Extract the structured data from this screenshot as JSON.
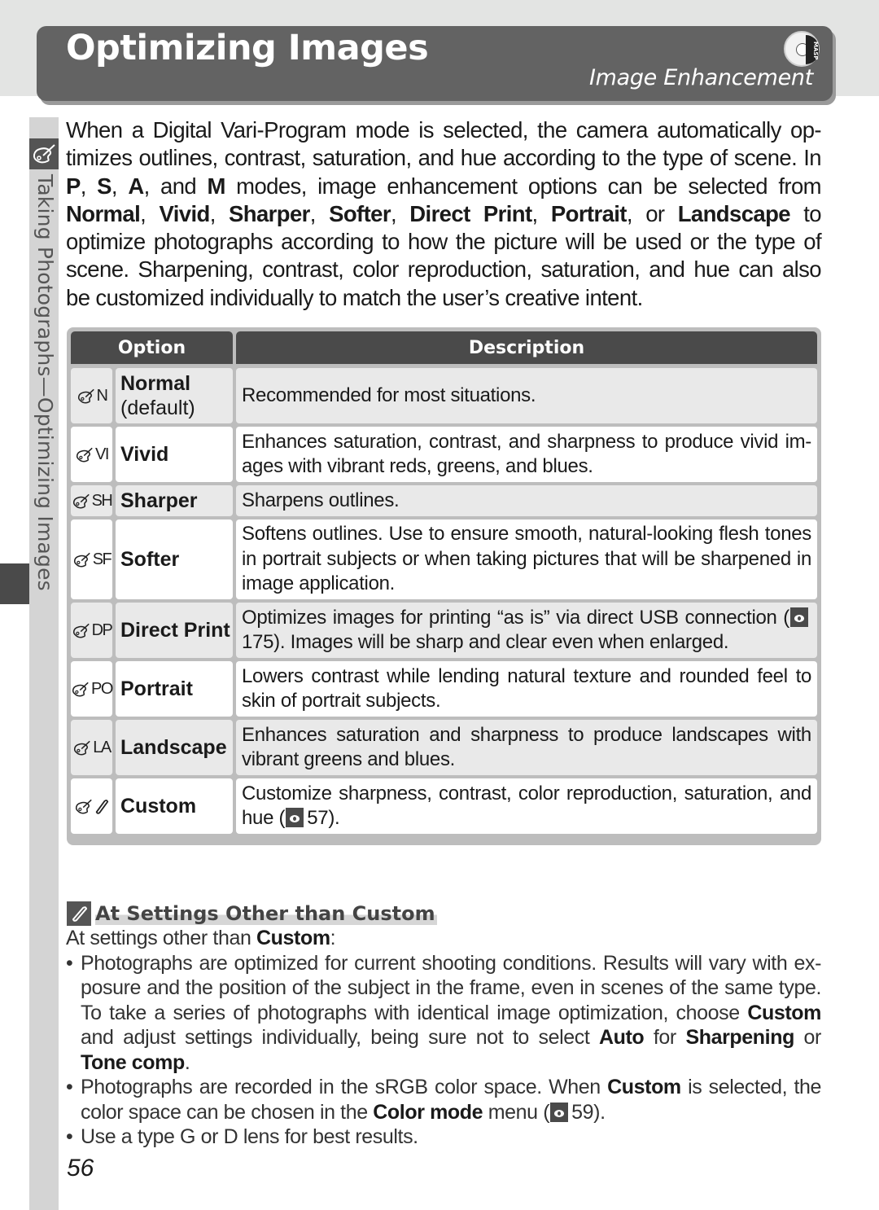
{
  "header": {
    "title": "Optimizing Images",
    "subtitle": "Image Enhancement",
    "dial_letters": "MASP"
  },
  "side_tab": {
    "label": "Taking Photographs—Optimizing Images"
  },
  "intro": {
    "parts": [
      {
        "t": "When a Digital Vari-Program mode is selected, the camera automatically op-timizes outlines, contrast, saturation, and hue according to the type of scene. In ",
        "b": false
      },
      {
        "t": "P",
        "b": true
      },
      {
        "t": ", ",
        "b": false
      },
      {
        "t": "S",
        "b": true
      },
      {
        "t": ", ",
        "b": false
      },
      {
        "t": "A",
        "b": true
      },
      {
        "t": ", and ",
        "b": false
      },
      {
        "t": "M",
        "b": true
      },
      {
        "t": " modes, image enhancement options can be selected from ",
        "b": false
      },
      {
        "t": "Normal",
        "b": true
      },
      {
        "t": ", ",
        "b": false
      },
      {
        "t": "Vivid",
        "b": true
      },
      {
        "t": ", ",
        "b": false
      },
      {
        "t": "Sharper",
        "b": true
      },
      {
        "t": ", ",
        "b": false
      },
      {
        "t": "Softer",
        "b": true
      },
      {
        "t": ", ",
        "b": false
      },
      {
        "t": "Direct Print",
        "b": true
      },
      {
        "t": ", ",
        "b": false
      },
      {
        "t": "Portrait",
        "b": true
      },
      {
        "t": ", or ",
        "b": false
      },
      {
        "t": "Landscape",
        "b": true
      },
      {
        "t": " to optimize photographs according to how the picture will be used or the type of scene.  Sharpening, contrast, color reproduction, saturation, and hue can also be customized individually to match the user’s creative intent.",
        "b": false
      }
    ]
  },
  "table": {
    "headers": {
      "option": "Option",
      "description": "Description"
    },
    "rows": [
      {
        "code": "N",
        "name": "Normal",
        "note": "(default)",
        "desc": "Recommended for most situations.",
        "ref": null,
        "desc_after": "",
        "bg": "grey",
        "h": 68
      },
      {
        "code": "VI",
        "name": "Vivid",
        "note": "",
        "desc": "Enhances saturation, contrast, and sharpness to produce vivid im-ages with vibrant reds, greens, and blues.",
        "ref": null,
        "desc_after": "",
        "bg": "white",
        "h": 68
      },
      {
        "code": "SH",
        "name": "Sharper",
        "note": "",
        "desc": "Sharpens outlines.",
        "ref": null,
        "desc_after": "",
        "bg": "grey",
        "h": 38
      },
      {
        "code": "SF",
        "name": "Softer",
        "note": "",
        "desc": "Softens outlines.  Use to ensure smooth, natural-looking flesh tones in portrait subjects or when taking pictures that will be sharpened in image application.",
        "ref": null,
        "desc_after": "",
        "bg": "white",
        "h": 98
      },
      {
        "code": "DP",
        "name": "Direct Print",
        "note": "",
        "desc": "Optimizes images for printing “as is” via direct USB connection (",
        "ref": "175",
        "desc_after": ").  Images will be sharp and clear even when enlarged.",
        "bg": "grey",
        "h": 68
      },
      {
        "code": "PO",
        "name": "Portrait",
        "note": "",
        "desc": "Lowers contrast while lending natural texture and rounded feel to skin of portrait subjects.",
        "ref": null,
        "desc_after": "",
        "bg": "white",
        "h": 68
      },
      {
        "code": "LA",
        "name": "Landscape",
        "note": "",
        "desc": "Enhances saturation and sharpness to produce landscapes with vibrant greens and blues.",
        "ref": null,
        "desc_after": "",
        "bg": "grey",
        "h": 68
      },
      {
        "code": "",
        "name": "Custom",
        "note": "",
        "desc": "Customize sharpness, contrast, color reproduction, saturation, and hue (",
        "ref": "57",
        "desc_after": ").",
        "bg": "white",
        "h": 68
      }
    ]
  },
  "note": {
    "title": "At Settings Other than Custom",
    "lead": [
      {
        "t": "At settings other than ",
        "b": false
      },
      {
        "t": "Custom",
        "b": true
      },
      {
        "t": ":",
        "b": false
      }
    ],
    "bullets": [
      [
        {
          "t": "Photographs are optimized for current shooting conditions.  Results will vary with ex-posure and the position of the subject in the frame, even in scenes of the same type.  To take a series of photographs with identical image optimization, choose ",
          "b": false
        },
        {
          "t": "Custom",
          "b": true
        },
        {
          "t": " and adjust settings individually, being sure not to select ",
          "b": false
        },
        {
          "t": "Auto",
          "b": true
        },
        {
          "t": " for ",
          "b": false
        },
        {
          "t": "Sharpening",
          "b": true
        },
        {
          "t": " or ",
          "b": false
        },
        {
          "t": "Tone comp",
          "b": true
        },
        {
          "t": ".",
          "b": false
        }
      ],
      [
        {
          "t": "Photographs are recorded in the sRGB color space.  When ",
          "b": false
        },
        {
          "t": "Custom",
          "b": true
        },
        {
          "t": " is selected, the color space can be chosen in the ",
          "b": false
        },
        {
          "t": "Color mode",
          "b": true
        },
        {
          "t": " menu (",
          "b": false
        },
        {
          "ref": "59"
        },
        {
          "t": ").",
          "b": false
        }
      ],
      [
        {
          "t": "Use a type G or D lens for best results.",
          "b": false
        }
      ]
    ]
  },
  "page_number": "56",
  "colors": {
    "header_bg": "#636363",
    "table_header_bg": "#4a4a4a",
    "row_grey": "#e9e9e9",
    "row_white": "#ffffff",
    "side_strip": "#d4d4d4"
  }
}
